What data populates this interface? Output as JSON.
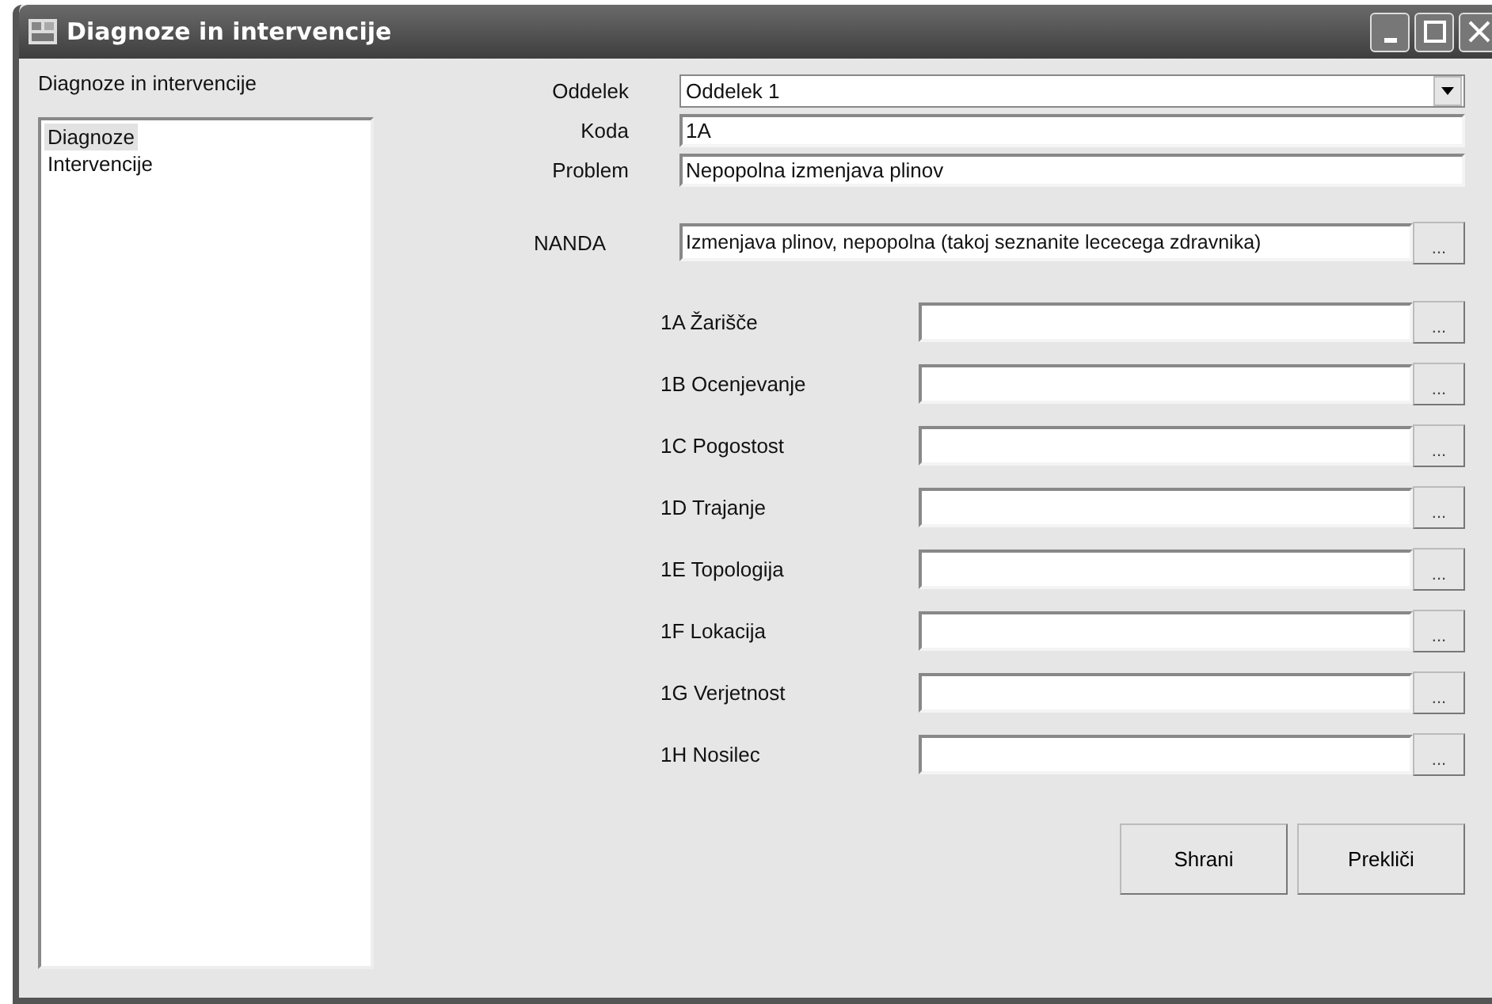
{
  "window": {
    "title": "Diagnoze in intervencije"
  },
  "left_panel": {
    "label": "Diagnoze in intervencije",
    "items": [
      {
        "label": "Diagnoze",
        "selected": true
      },
      {
        "label": "Intervencije",
        "selected": false
      }
    ]
  },
  "oddelek": {
    "label": "Oddelek",
    "value": "Oddelek 1"
  },
  "koda": {
    "label": "Koda",
    "value": "1A"
  },
  "problem": {
    "label": "Problem",
    "value": "Nepopolna izmenjava plinov"
  },
  "nanda": {
    "label": "NANDA",
    "value": "Izmenjava plinov, nepopolna (takoj seznanite lececega zdravnika)",
    "button": "..."
  },
  "attributes": [
    {
      "label": "1A Žarišče",
      "button": "..."
    },
    {
      "label": "1B Ocenjevanje",
      "button": "..."
    },
    {
      "label": "1C Pogostost",
      "button": "..."
    },
    {
      "label": "1D Trajanje",
      "button": "..."
    },
    {
      "label": "1E Topologija",
      "button": "..."
    },
    {
      "label": "1F Lokacija",
      "button": "..."
    },
    {
      "label": "1G Verjetnost",
      "button": "..."
    },
    {
      "label": "1H Nosilec",
      "button": "..."
    }
  ],
  "buttons": [
    "Shrani",
    "Prekliči"
  ]
}
